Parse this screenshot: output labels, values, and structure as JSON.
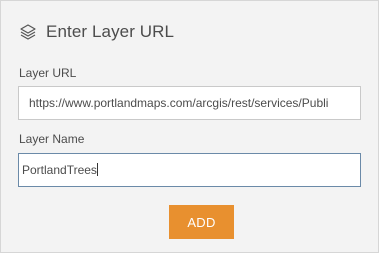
{
  "panel": {
    "title": "Enter Layer URL",
    "title_icon": "layers-icon"
  },
  "layer_url": {
    "label": "Layer URL",
    "value": "https://www.portlandmaps.com/arcgis/rest/services/Publi"
  },
  "layer_name": {
    "label": "Layer Name",
    "value": "PortlandTrees"
  },
  "actions": {
    "add_label": "ADD",
    "add_color": "#e8902f"
  }
}
